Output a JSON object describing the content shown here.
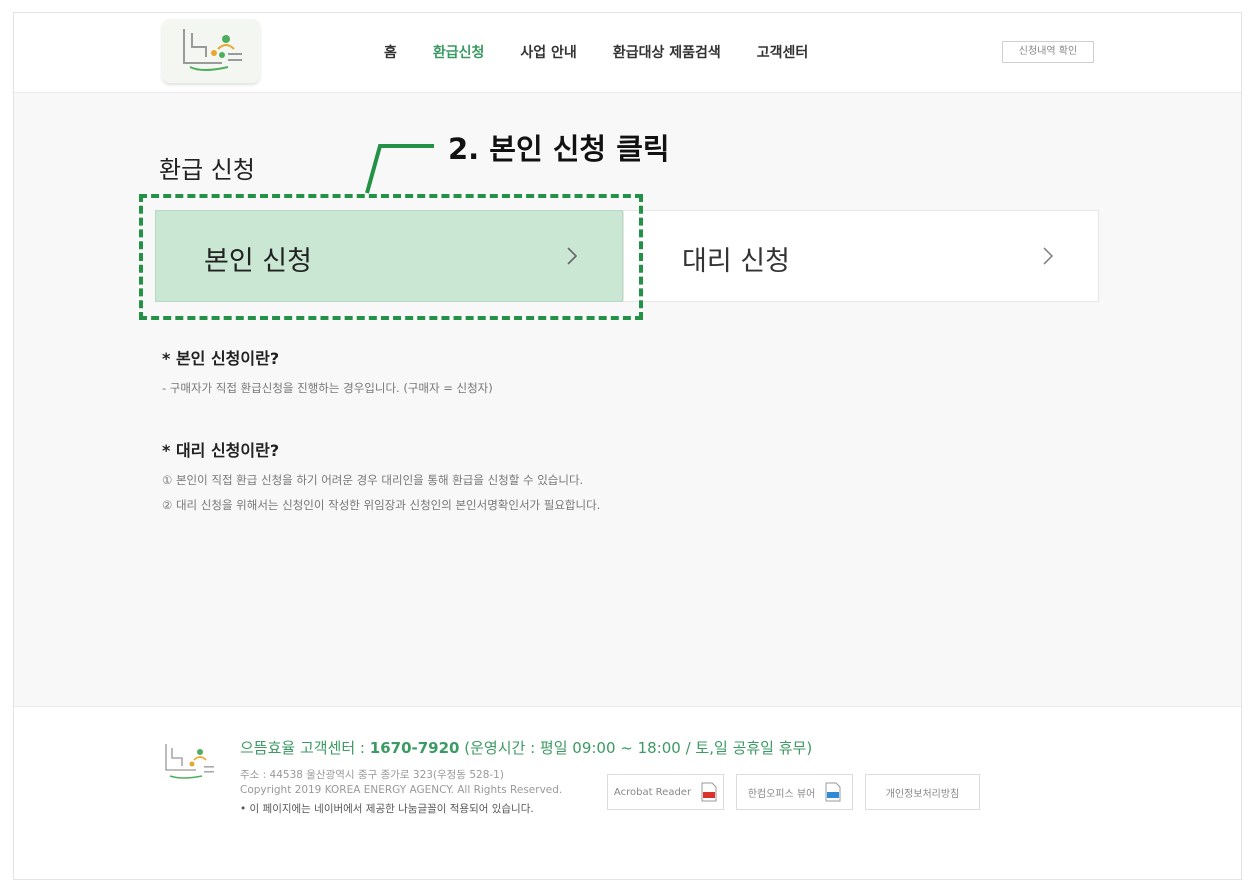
{
  "header": {
    "nav": [
      {
        "label": "홈",
        "active": false
      },
      {
        "label": "환급신청",
        "active": true
      },
      {
        "label": "사업 안내",
        "active": false
      },
      {
        "label": "환급대상 제품검색",
        "active": false
      },
      {
        "label": "고객센터",
        "active": false
      }
    ],
    "check_button": "신청내역 확인"
  },
  "page_title": "환급 신청",
  "annotation": "2. 본인 신청 클릭",
  "cards": {
    "self_label": "본인 신청",
    "proxy_label": "대리 신청"
  },
  "info": {
    "self_title": "* 본인 신청이란?",
    "self_desc": "- 구매자가 직접 환급신청을 진행하는 경우입니다. (구매자 = 신청자)",
    "proxy_title": "* 대리 신청이란?",
    "proxy_desc_1": "① 본인이 직접 환급 신청을 하기 어려운 경우 대리인을 통해 환급을 신청할 수 있습니다.",
    "proxy_desc_2": "② 대리 신청을 위해서는 신청인이 작성한 위임장과 신청인의 본인서명확인서가 필요합니다."
  },
  "footer": {
    "hotline_prefix": "으뜸효율 고객센터 : ",
    "hotline_number": "1670-7920",
    "hotline_hours": " (운영시간 : 평일 09:00 ~ 18:00 / 토,일 공휴일 휴무)",
    "address": "주소 : 44538 울산광역시 중구 종가로 323(우정동 528-1)",
    "copyright": "Copyright 2019 KOREA ENERGY AGENCY. All Rights Reserved.",
    "font_notice": "• 이 페이지에는 네이버에서 제공한 나눔글꼴이 적용되어 있습니다.",
    "buttons": {
      "acrobat": "Acrobat Reader",
      "hancom": "한컴오피스 뷰어",
      "privacy": "개인정보처리방침"
    }
  },
  "colors": {
    "accent_green": "#3a9a63",
    "highlight_green": "#239247",
    "selected_card_bg": "#c9e7d3"
  }
}
